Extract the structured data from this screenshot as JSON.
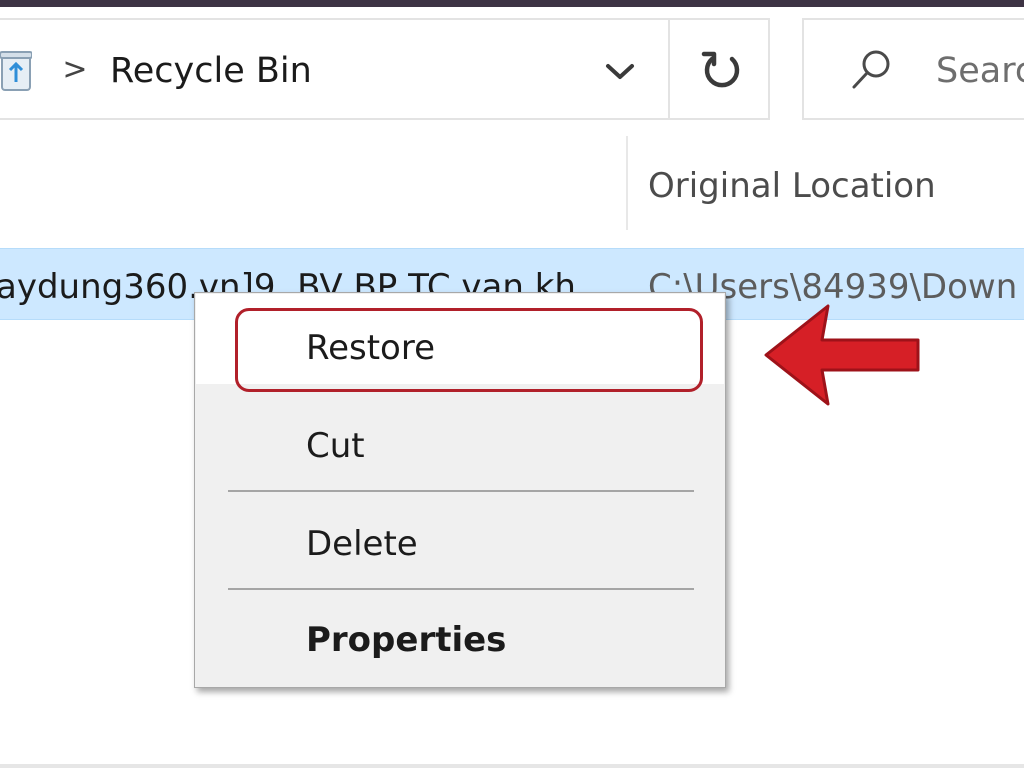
{
  "address_bar": {
    "breadcrumb_separator": ">",
    "location": "Recycle Bin",
    "icons": [
      "recycle-bin-icon",
      "chevron-right-icon",
      "chevron-down-icon",
      "refresh-icon"
    ]
  },
  "search": {
    "placeholder": "Searc",
    "icon": "search-icon"
  },
  "columns": {
    "original_location": "Original Location"
  },
  "file": {
    "name": "aydung360.vn]9. BV BP TC van kh",
    "original_location": "C:\\Users\\84939\\Down"
  },
  "context_menu": {
    "items": [
      {
        "label": "Restore",
        "highlighted": true
      },
      {
        "label": "Cut"
      },
      {
        "label": "Delete"
      },
      {
        "label": "Properties",
        "bold": true
      }
    ]
  },
  "colors": {
    "selection_background": "#cde8ff",
    "menu_background": "#f0f0f0",
    "highlight_border": "#b1202a",
    "arrow": "#d61f26",
    "top_strip": "#3d3344"
  }
}
